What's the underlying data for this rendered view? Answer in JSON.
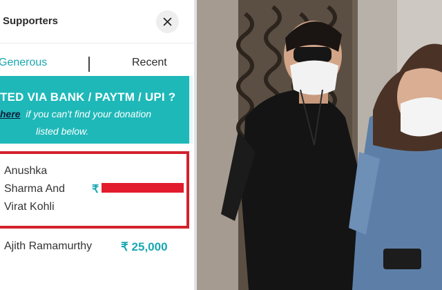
{
  "header": {
    "title": "Supporters"
  },
  "tabs": [
    {
      "label": "Generous",
      "active": true
    },
    {
      "label": "Recent",
      "active": false
    }
  ],
  "banner": {
    "title": "TED VIA BANK / PAYTM / UPI ?",
    "link_text": "here",
    "line2_rest": "if you can't find your donation",
    "line3": "listed below."
  },
  "donations": [
    {
      "name": "Anushka Sharma And Virat Kohli",
      "currency": "₹",
      "amount_redacted": true
    },
    {
      "name": "Ajith Ramamurthy",
      "amount": "₹ 25,000"
    }
  ],
  "colors": {
    "accent": "#1fb8b9",
    "highlight": "#d3212c"
  },
  "icons": {
    "close": "close-icon"
  }
}
